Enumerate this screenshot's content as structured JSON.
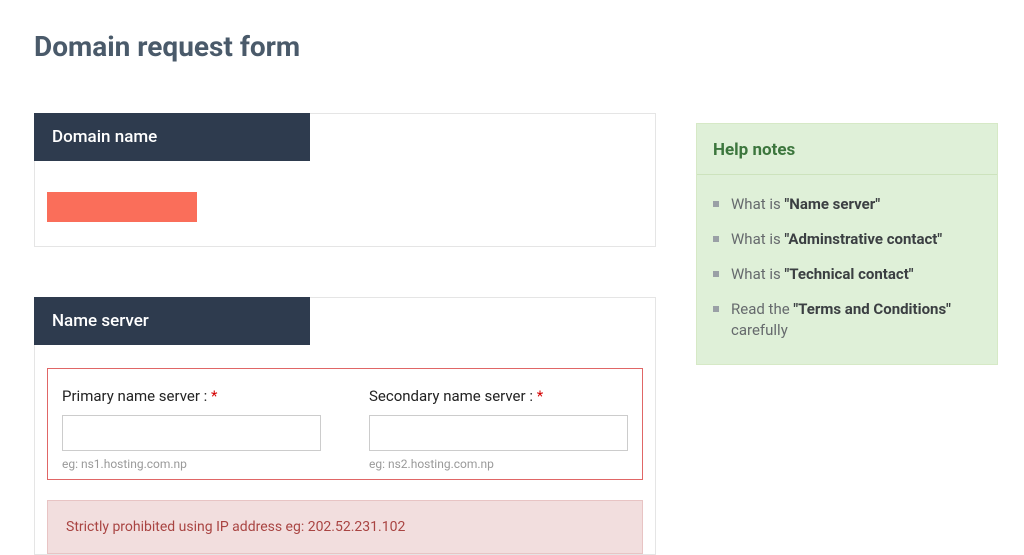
{
  "page": {
    "title": "Domain request form"
  },
  "domain_section": {
    "header": "Domain name",
    "value": ""
  },
  "nameserver_section": {
    "header": "Name server",
    "primary": {
      "label": "Primary name server :",
      "required_mark": "*",
      "value": "",
      "hint": "eg: ns1.hosting.com.np"
    },
    "secondary": {
      "label": "Secondary name server :",
      "required_mark": "*",
      "value": "",
      "hint": "eg: ns2.hosting.com.np"
    },
    "warning": "Strictly prohibited using IP address eg: 202.52.231.102"
  },
  "help": {
    "header": "Help notes",
    "items": [
      {
        "prefix": "What is ",
        "bold": "\"Name server\"",
        "suffix": ""
      },
      {
        "prefix": "What is ",
        "bold": "\"Adminstrative contact\"",
        "suffix": ""
      },
      {
        "prefix": "What is ",
        "bold": "\"Technical contact\"",
        "suffix": ""
      },
      {
        "prefix": "Read the ",
        "bold": "\"Terms and Conditions\"",
        "suffix": " carefully"
      }
    ]
  }
}
